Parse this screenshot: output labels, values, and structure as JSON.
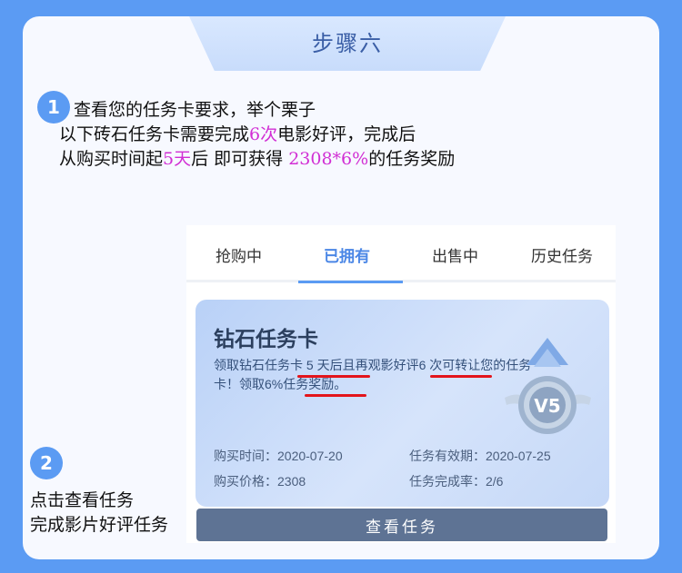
{
  "step_title": "步骤六",
  "step1": {
    "badge": "1",
    "line1": "查看您的任务卡要求，举个栗子",
    "line2_a": "以下砖石任务卡需要完成",
    "line2_hl": "6次",
    "line2_b": "电影好评，完成后",
    "line3_a": "从购买时间起",
    "line3_hl1": "5天",
    "line3_b": "后 即可获得 ",
    "line3_hl2": "2308*6%",
    "line3_c": "的任务奖励"
  },
  "step2": {
    "badge": "2",
    "line1": "点击查看任务",
    "line2": "完成影片好评任务"
  },
  "app": {
    "tabs": [
      "抢购中",
      "已拥有",
      "出售中",
      "历史任务"
    ],
    "active_tab": "已拥有",
    "card": {
      "title": "钻石任务卡",
      "desc": "领取钻石任务卡 5 天后且再观影好评6 次可转让您的任务卡！领取6%任务奖励。",
      "emblem_text": "V5",
      "purchase_time_label": "购买时间：",
      "purchase_time": "2020-07-20",
      "valid_until_label": "任务有效期：",
      "valid_until": "2020-07-25",
      "price_label": "购买价格：",
      "price": "2308",
      "completion_label": "任务完成率：",
      "completion": "2/6"
    },
    "view_button": "查看任务"
  },
  "colors": {
    "frame": "#5b9bf3",
    "highlight": "#d12ed4",
    "active_tab": "#4b87e6",
    "button": "#5e7394",
    "annotation": "#e3141b"
  }
}
